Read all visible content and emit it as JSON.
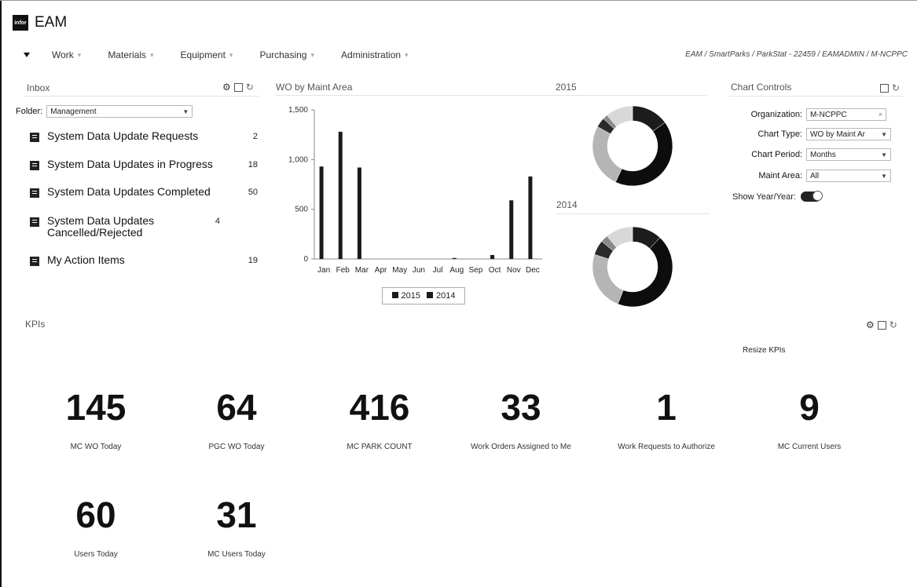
{
  "app": {
    "logo_text": "infor",
    "title": "EAM"
  },
  "nav": {
    "items": [
      "Work",
      "Materials",
      "Equipment",
      "Purchasing",
      "Administration"
    ],
    "breadcrumb": "EAM / SmartParks / ParkStat - 22459 / EAMADMIN / M-NCPPC"
  },
  "inbox": {
    "title": "Inbox",
    "folder_label": "Folder:",
    "folder_value": "Management",
    "items": [
      {
        "label": "System Data Update Requests",
        "count": "2"
      },
      {
        "label": "System Data Updates in Progress",
        "count": "18"
      },
      {
        "label": "System Data Updates Completed",
        "count": "50"
      },
      {
        "label": "System Data Updates Cancelled/Rejected",
        "count": "4"
      },
      {
        "label": "My Action Items",
        "count": "19"
      }
    ]
  },
  "chart_panel": {
    "title": "WO by Maint Area",
    "donut_2015_label": "2015",
    "donut_2014_label": "2014"
  },
  "chart_data": [
    {
      "type": "bar",
      "categories": [
        "Jan",
        "Feb",
        "Mar",
        "Apr",
        "May",
        "Jun",
        "Jul",
        "Aug",
        "Sep",
        "Oct",
        "Nov",
        "Dec"
      ],
      "series": [
        {
          "name": "2015",
          "values": [
            930,
            1280,
            920,
            0,
            0,
            0,
            0,
            10,
            0,
            40,
            590,
            830
          ]
        },
        {
          "name": "2014",
          "values": [
            0,
            0,
            0,
            0,
            0,
            0,
            0,
            0,
            0,
            0,
            0,
            0
          ]
        }
      ],
      "yticks": [
        "1,500",
        "1,000",
        "500",
        "0"
      ],
      "ylim": [
        0,
        1500
      ],
      "legend": "bottom"
    },
    {
      "type": "pie",
      "title": "2015",
      "values": [
        15,
        42,
        26,
        4,
        2,
        11
      ],
      "colors": [
        "#1c1c1c",
        "#0d0d0d",
        "#b5b5b5",
        "#2a2a2a",
        "#8a8a8a",
        "#d8d8d8"
      ]
    },
    {
      "type": "pie",
      "title": "2014",
      "values": [
        12,
        44,
        24,
        6,
        3,
        11
      ],
      "colors": [
        "#1c1c1c",
        "#0d0d0d",
        "#b5b5b5",
        "#2a2a2a",
        "#8a8a8a",
        "#d8d8d8"
      ]
    }
  ],
  "chart_controls": {
    "title": "Chart Controls",
    "organization_label": "Organization:",
    "organization_value": "M-NCPPC",
    "chart_type_label": "Chart Type:",
    "chart_type_value": "WO by Maint Ar",
    "chart_period_label": "Chart Period:",
    "chart_period_value": "Months",
    "maint_area_label": "Maint Area:",
    "maint_area_value": "All",
    "show_yoy_label": "Show Year/Year:"
  },
  "kpis": {
    "title": "KPIs",
    "resize_label": "Resize KPIs",
    "items": [
      {
        "value": "145",
        "label": "MC WO Today"
      },
      {
        "value": "64",
        "label": "PGC WO Today"
      },
      {
        "value": "416",
        "label": "MC PARK COUNT"
      },
      {
        "value": "33",
        "label": "Work Orders Assigned to Me"
      },
      {
        "value": "1",
        "label": "Work Requests to Authorize"
      },
      {
        "value": "9",
        "label": "MC Current Users"
      },
      {
        "value": "60",
        "label": "Users Today"
      },
      {
        "value": "31",
        "label": "MC Users Today"
      }
    ]
  }
}
